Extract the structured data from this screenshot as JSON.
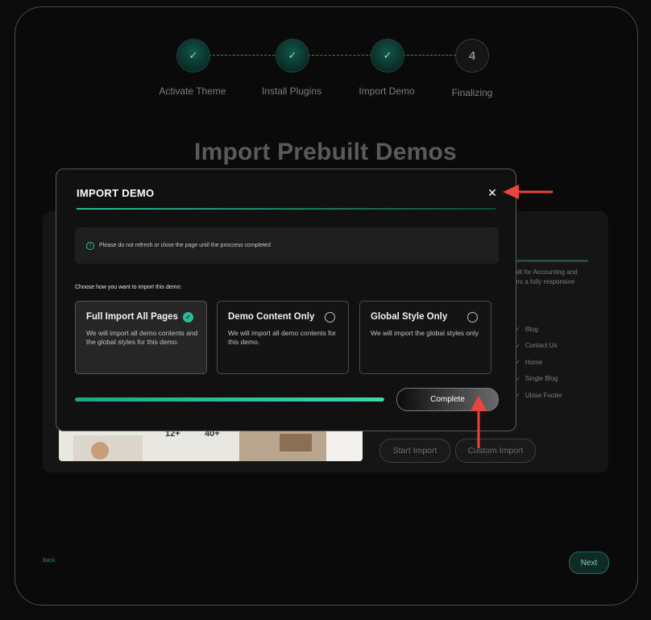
{
  "stepper": {
    "steps": [
      {
        "label": "Activate Theme",
        "status": "done"
      },
      {
        "label": "Install Plugins",
        "status": "done"
      },
      {
        "label": "Import Demo",
        "status": "done"
      },
      {
        "label": "Finalizing",
        "status": "pending",
        "number": "4"
      }
    ],
    "check_glyph": "✓"
  },
  "background": {
    "title": "Import Prebuilt Demos",
    "card_desc_line1": "uilt for Accounting and",
    "card_desc_line2": "ers a fully responsive",
    "pages": [
      "Blog",
      "Contact Us",
      "Home",
      "Single Blog",
      "Ubise Footer"
    ],
    "stat1": "12+",
    "stat2": "40+",
    "start_import_label": "Start Import",
    "custom_import_label": "Custom Import",
    "back_label": "Back",
    "next_label": "Next"
  },
  "modal": {
    "title": "IMPORT DEMO",
    "notice": "Please do not refresh or close the page until the proccess completed",
    "choose_label": "Choose how you want to import this demo:",
    "options": [
      {
        "title": "Full Import All Pages",
        "desc": "We will import all demo contents and the global styles for this demo.",
        "selected": true
      },
      {
        "title": "Demo Content Only",
        "desc": "We will import all demo contents for this demo.",
        "selected": false
      },
      {
        "title": "Global Style Only",
        "desc": "We will import the global styles only",
        "selected": false
      }
    ],
    "progress_percent": 100,
    "complete_label": "Complete"
  },
  "colors": {
    "accent": "#2bbd97",
    "annotation": "#e8463c"
  }
}
